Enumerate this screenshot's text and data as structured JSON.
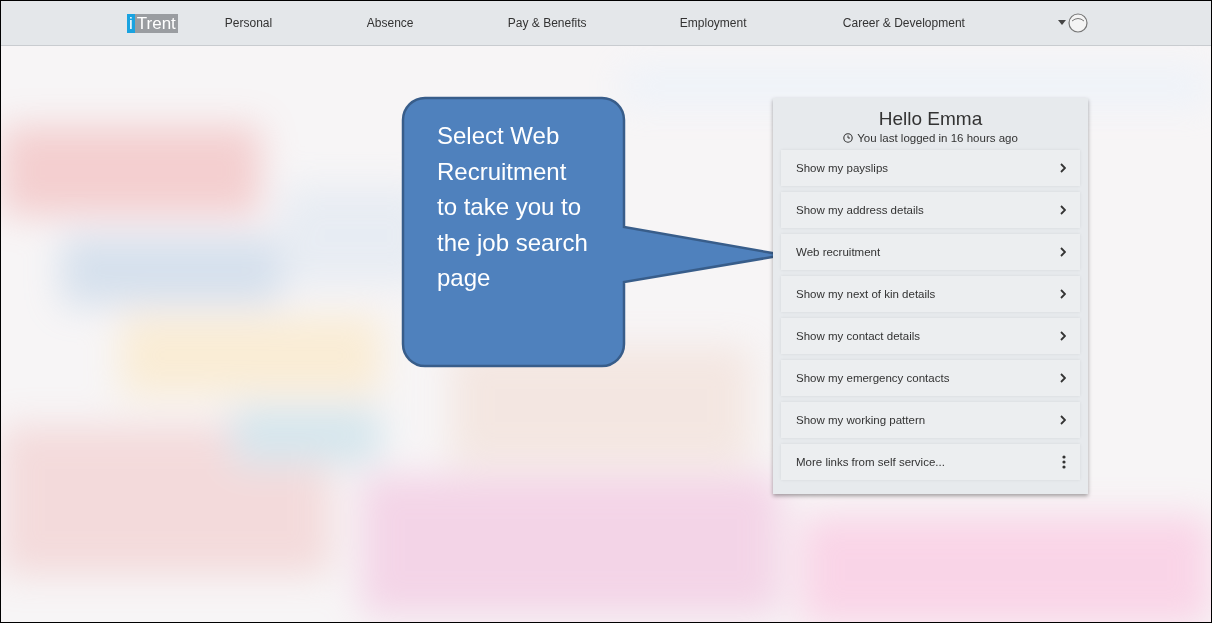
{
  "nav": {
    "logo": {
      "letter": "i",
      "word": "Trent"
    },
    "items": [
      {
        "label": "Personal"
      },
      {
        "label": "Absence"
      },
      {
        "label": "Pay & Benefits"
      },
      {
        "label": "Employment"
      },
      {
        "label": "Career & Development"
      }
    ]
  },
  "callout": {
    "text": "Select Web Recruitment to take you to the job search page"
  },
  "card": {
    "greeting": "Hello Emma",
    "last_login": "You last logged in 16 hours ago",
    "links": [
      {
        "kind": "link",
        "label": "Show my payslips"
      },
      {
        "kind": "link",
        "label": "Show my address details"
      },
      {
        "kind": "link",
        "label": "Web recruitment"
      },
      {
        "kind": "link",
        "label": "Show my next of kin details"
      },
      {
        "kind": "link",
        "label": "Show my contact details"
      },
      {
        "kind": "link",
        "label": "Show my emergency contacts"
      },
      {
        "kind": "link",
        "label": "Show my working pattern"
      },
      {
        "kind": "more",
        "label": "More links from self service..."
      }
    ]
  }
}
